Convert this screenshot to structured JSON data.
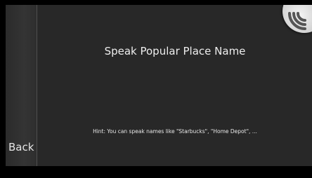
{
  "screen": {
    "back_label": "Back",
    "title": "Speak Popular Place Name",
    "hint": "Hint: You can speak names like \"Starbucks\", \"Home Depot\", ..."
  },
  "icons": {
    "voice_button": "speech-waves-icon"
  },
  "colors": {
    "background": "#282828",
    "text": "#eeeeee",
    "voice_button": "#d8d8d8"
  }
}
